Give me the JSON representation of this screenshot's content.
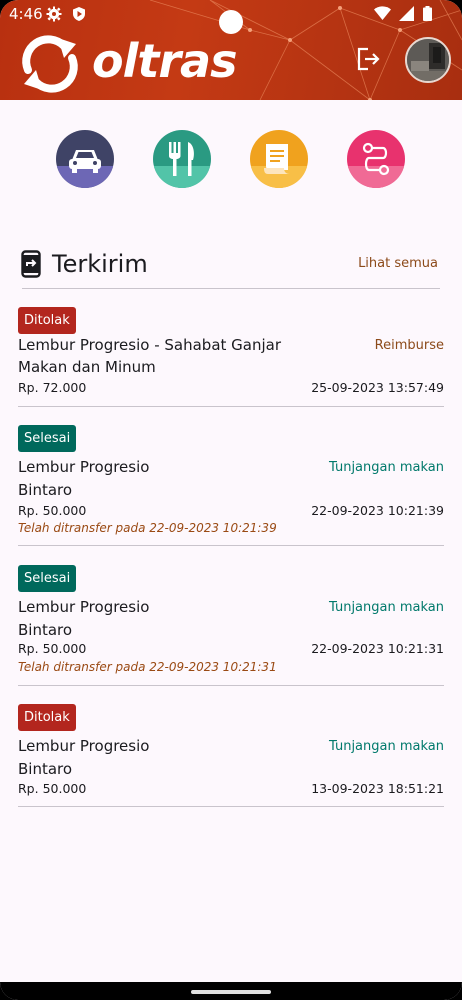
{
  "status_bar": {
    "time": "4:46",
    "left_icons": [
      "gear-icon",
      "play-shield-icon"
    ],
    "right_icons": [
      "wifi-icon",
      "signal-icon",
      "battery-icon"
    ]
  },
  "header": {
    "app_name": "oltras",
    "logo_icon": "sync-arrows-icon",
    "logout_icon": "logout-icon",
    "avatar": "profile-avatar"
  },
  "categories": [
    {
      "name": "transport",
      "icon": "car-icon",
      "color_top": "#3f4366",
      "color_bottom": "#6d67b5"
    },
    {
      "name": "meal",
      "icon": "fork-knife-icon",
      "color_top": "#2a9a82",
      "color_bottom": "#52c4a8"
    },
    {
      "name": "receipt",
      "icon": "receipt-icon",
      "color_top": "#f0a21e",
      "color_bottom": "#f8bf47"
    },
    {
      "name": "route",
      "icon": "route-icon",
      "color_top": "#e8326e",
      "color_bottom": "#f06a95"
    }
  ],
  "section": {
    "icon": "phone-send-icon",
    "title": "Terkirim",
    "see_all": "Lihat semua"
  },
  "items": [
    {
      "status": "Ditolak",
      "status_color": "#b3261e",
      "title_line1": "Lembur Progresio - Sahabat Ganjar",
      "title_line2": "Makan dan Minum",
      "category": "Reimburse",
      "amount": "Rp. 72.000",
      "datetime": "25-09-2023 13:57:49",
      "note": ""
    },
    {
      "status": "Selesai",
      "status_color": "#00695c",
      "title_line1": "Lembur Progresio",
      "title_line2": "Bintaro",
      "category": "Tunjangan makan",
      "amount": "Rp. 50.000",
      "datetime": "22-09-2023 10:21:39",
      "note": "Telah ditransfer pada 22-09-2023 10:21:39"
    },
    {
      "status": "Selesai",
      "status_color": "#00695c",
      "title_line1": "Lembur Progresio",
      "title_line2": "Bintaro",
      "category": "Tunjangan makan",
      "amount": "Rp. 50.000",
      "datetime": "22-09-2023 10:21:31",
      "note": "Telah ditransfer pada 22-09-2023 10:21:31"
    },
    {
      "status": "Ditolak",
      "status_color": "#b3261e",
      "title_line1": "Lembur Progresio",
      "title_line2": "Bintaro",
      "category": "Tunjangan makan",
      "amount": "Rp. 50.000",
      "datetime": "13-09-2023 18:51:21",
      "note": ""
    }
  ]
}
